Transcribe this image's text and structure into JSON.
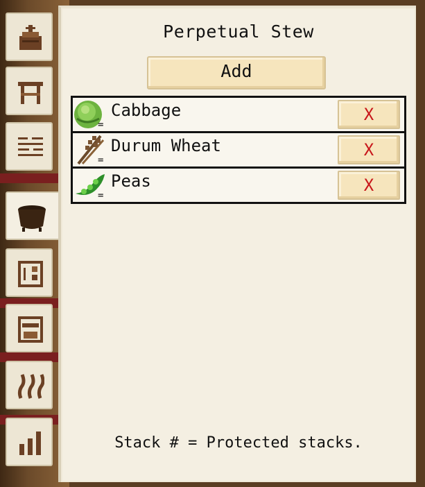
{
  "window": {
    "title": "Perpetual Stew"
  },
  "toolbar": {
    "add_label": "Add"
  },
  "ingredients": [
    {
      "name": "Cabbage",
      "icon": "cabbage-icon",
      "stack_mark": "=",
      "remove_label": "X"
    },
    {
      "name": "Durum Wheat",
      "icon": "wheat-icon",
      "stack_mark": "=",
      "remove_label": "X"
    },
    {
      "name": "Peas",
      "icon": "peas-icon",
      "stack_mark": "=",
      "remove_label": "X"
    }
  ],
  "footer": {
    "note": "Stack # = Protected stacks."
  },
  "tabs": [
    {
      "id": "shrine",
      "icon": "shrine-icon",
      "active": false
    },
    {
      "id": "table",
      "icon": "table-icon",
      "active": false
    },
    {
      "id": "list",
      "icon": "list-icon",
      "active": false
    },
    {
      "id": "pot",
      "icon": "cooking-pot-icon",
      "active": true
    },
    {
      "id": "storage",
      "icon": "storage-icon",
      "active": false
    },
    {
      "id": "oven",
      "icon": "oven-icon",
      "active": false
    },
    {
      "id": "heat",
      "icon": "heat-icon",
      "active": false
    },
    {
      "id": "stats",
      "icon": "stats-icon",
      "active": false
    }
  ],
  "colors": {
    "panel": "#f4efe2",
    "button": "#f6e5bd",
    "remove_x": "#c8171b",
    "border": "#111111"
  }
}
